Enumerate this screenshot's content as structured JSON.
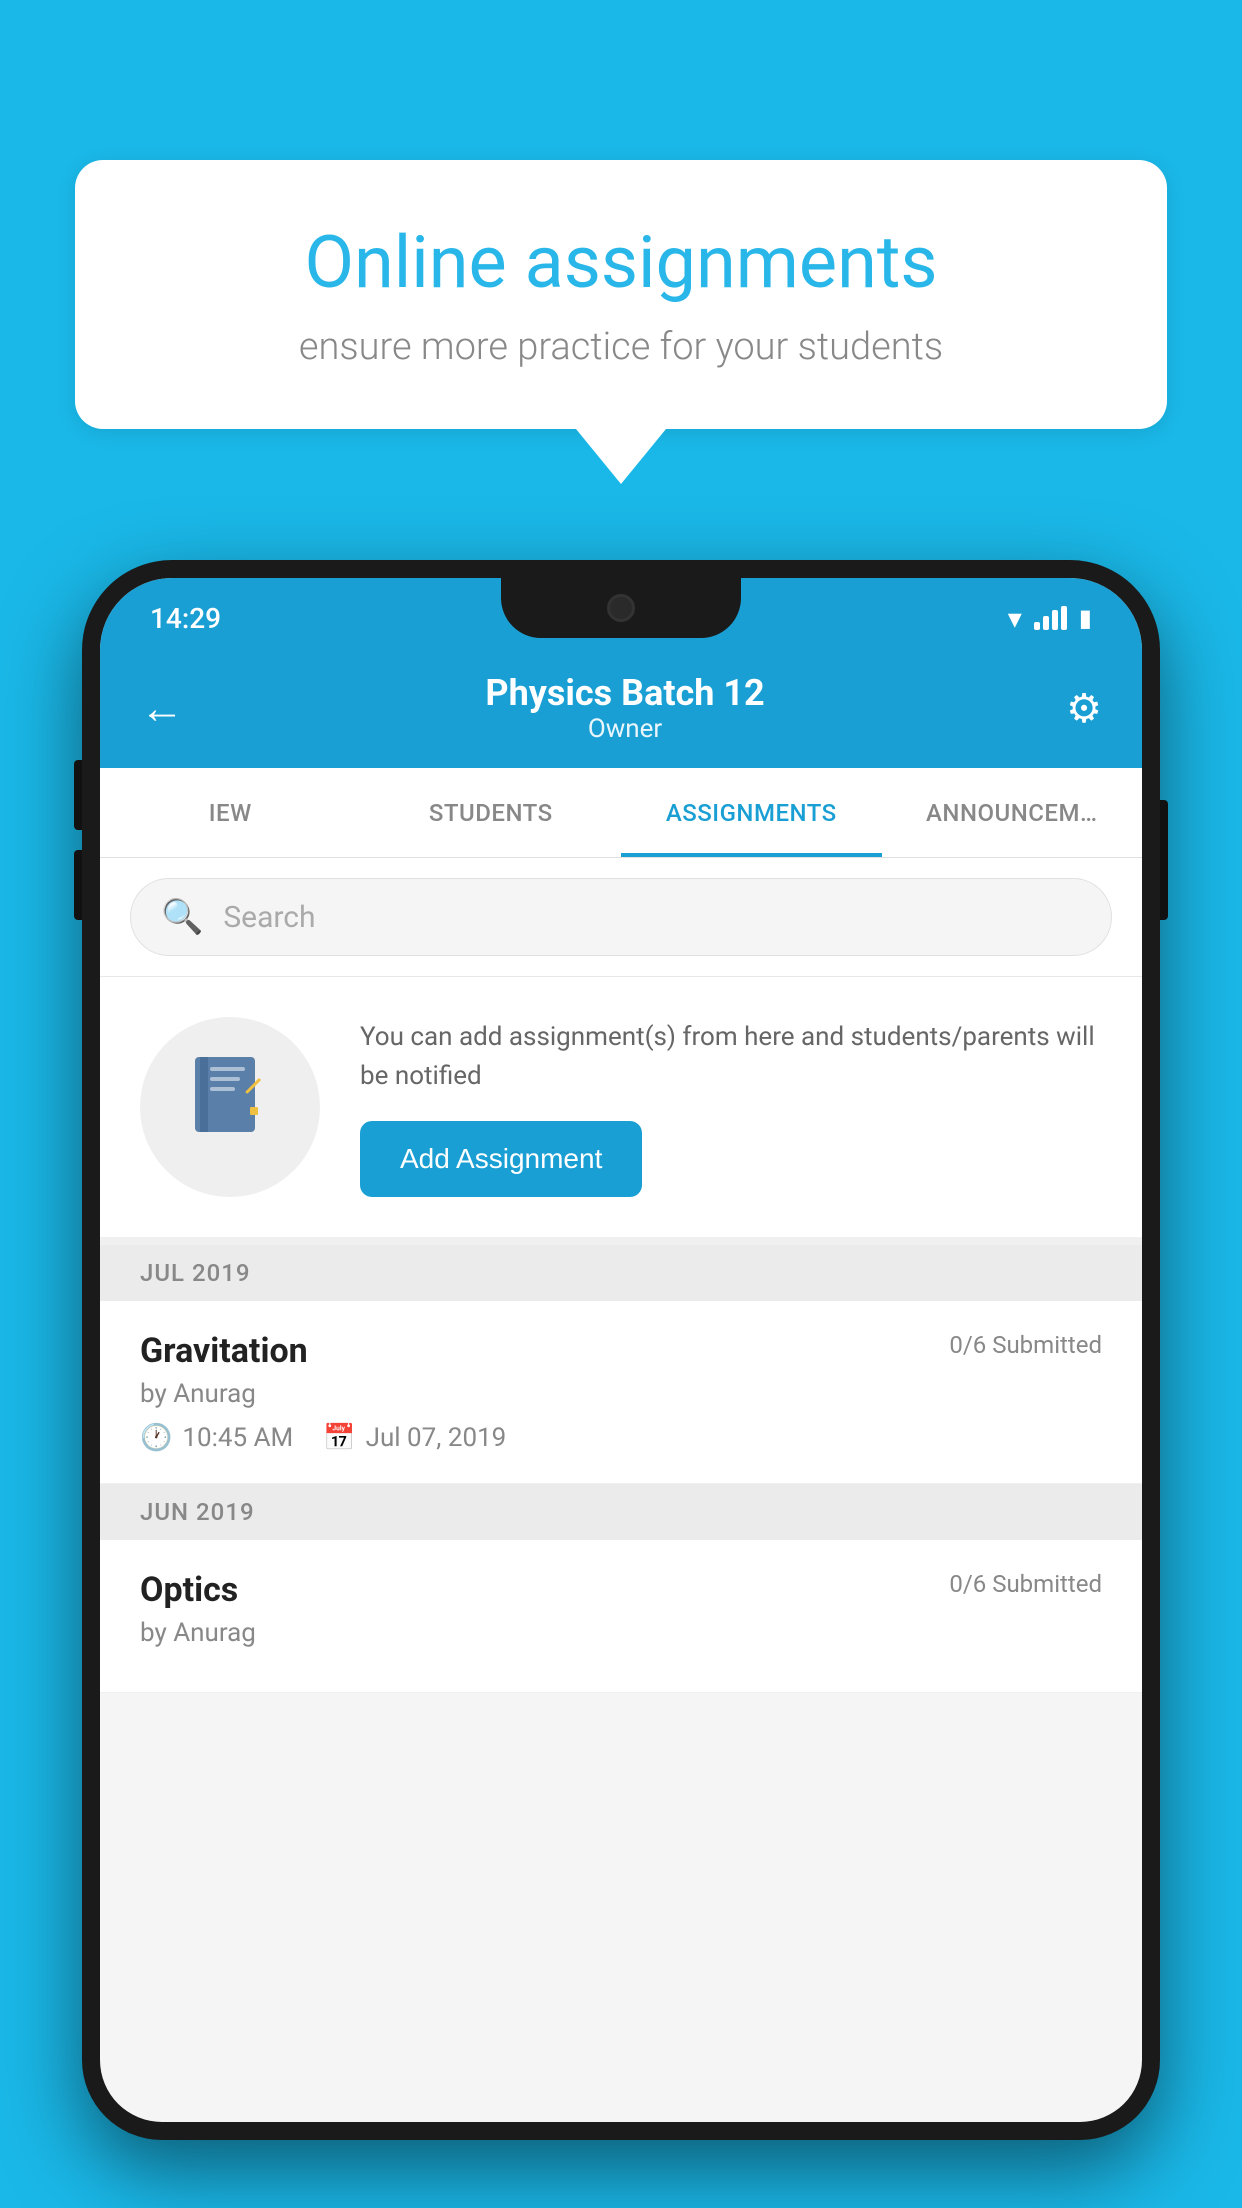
{
  "background_color": "#1ab8e8",
  "speech_bubble": {
    "title": "Online assignments",
    "subtitle": "ensure more practice for your students"
  },
  "phone": {
    "status_bar": {
      "time": "14:29"
    },
    "header": {
      "title": "Physics Batch 12",
      "subtitle": "Owner",
      "back_label": "←",
      "settings_label": "⚙"
    },
    "tabs": [
      {
        "label": "IEW",
        "active": false
      },
      {
        "label": "STUDENTS",
        "active": false
      },
      {
        "label": "ASSIGNMENTS",
        "active": true
      },
      {
        "label": "ANNOUNCEM…",
        "active": false
      }
    ],
    "search": {
      "placeholder": "Search"
    },
    "info_card": {
      "icon": "📓",
      "text": "You can add assignment(s) from here and students/parents will be notified",
      "button_label": "Add Assignment"
    },
    "month_groups": [
      {
        "month": "JUL 2019",
        "assignments": [
          {
            "title": "Gravitation",
            "submitted": "0/6 Submitted",
            "by": "by Anurag",
            "time": "10:45 AM",
            "date": "Jul 07, 2019"
          }
        ]
      },
      {
        "month": "JUN 2019",
        "assignments": [
          {
            "title": "Optics",
            "submitted": "0/6 Submitted",
            "by": "by Anurag",
            "time": "",
            "date": ""
          }
        ]
      }
    ]
  }
}
